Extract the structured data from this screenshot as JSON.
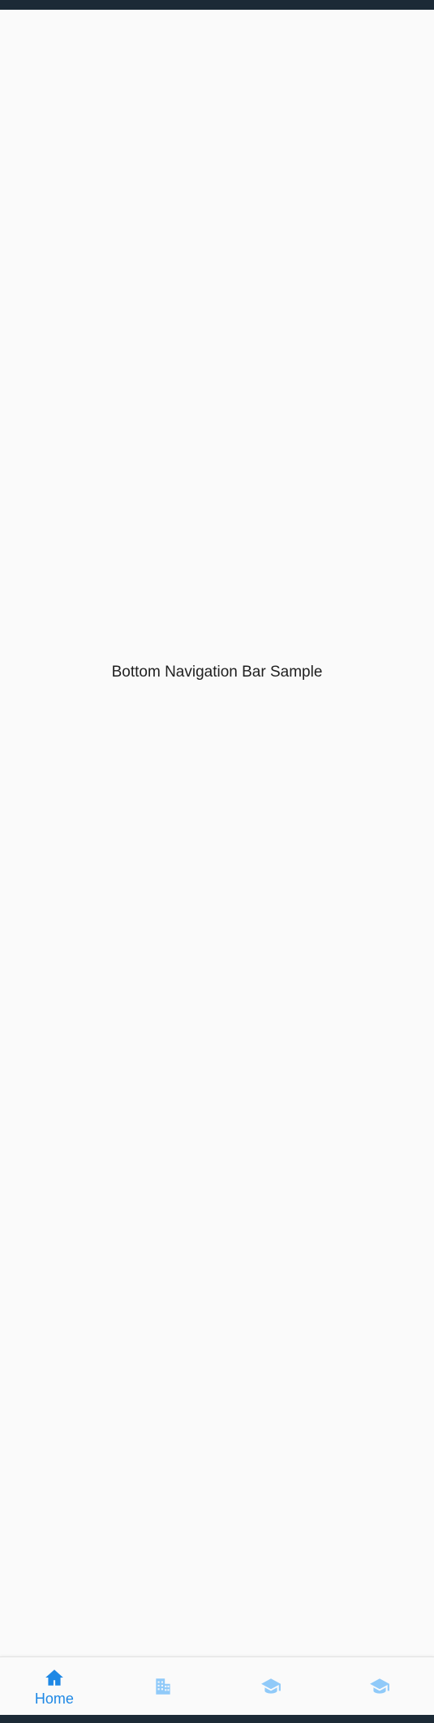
{
  "main": {
    "center_text": "Bottom Navigation Bar Sample"
  },
  "bottom_nav": {
    "items": [
      {
        "label": "Home",
        "icon": "home-icon",
        "active": true
      },
      {
        "label": "",
        "icon": "business-icon",
        "active": false
      },
      {
        "label": "",
        "icon": "school-icon",
        "active": false
      },
      {
        "label": "",
        "icon": "school-icon",
        "active": false
      }
    ]
  },
  "colors": {
    "status_bar": "#1c2a36",
    "background": "#fafafa",
    "active": "#1e88e5",
    "inactive": "#90caf9",
    "text": "#1f1f1f"
  }
}
